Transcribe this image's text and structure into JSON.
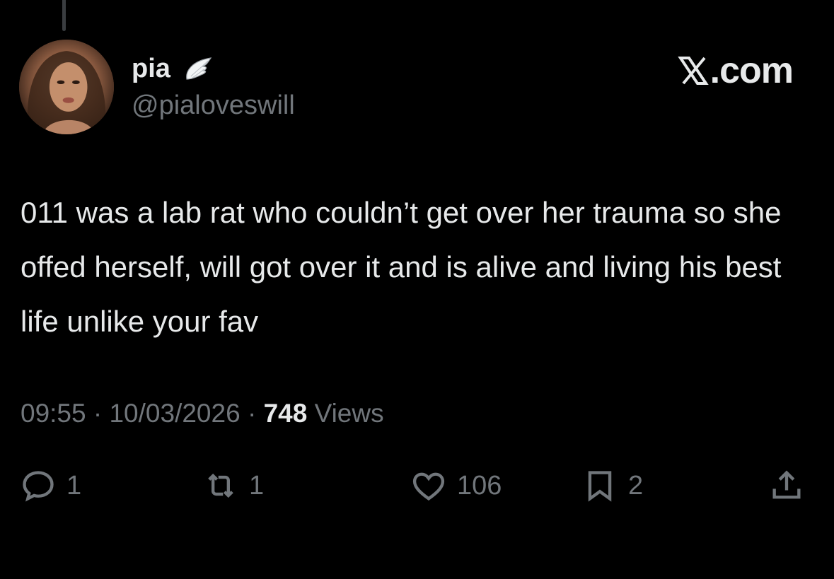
{
  "author": {
    "display_name": "pia",
    "handle": "@pialoveswill",
    "badge_icon": "angel-wing-icon"
  },
  "brand": {
    "text": ".com",
    "logo_icon": "x-logo-icon"
  },
  "tweet": {
    "text": "011 was a lab rat who couldn’t get over her trauma so she offed herself, will got over it and is alive and living his best life unlike your fav"
  },
  "meta": {
    "time": "09:55",
    "separator": "·",
    "date": "10/03/2026",
    "views_count": "748",
    "views_label": "Views"
  },
  "actions": {
    "reply_count": "1",
    "retweet_count": "1",
    "like_count": "106",
    "bookmark_count": "2"
  },
  "colors": {
    "background": "#000000",
    "text_primary": "#e7e9ea",
    "text_secondary": "#71767b"
  }
}
